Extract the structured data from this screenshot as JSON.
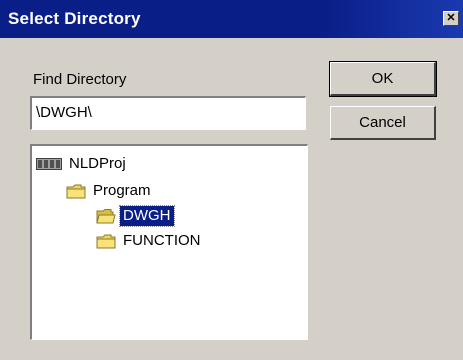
{
  "window": {
    "title": "Select Directory",
    "close_glyph": "✕"
  },
  "find": {
    "label": "Find Directory",
    "value": "\\DWGH\\"
  },
  "buttons": {
    "ok": "OK",
    "cancel": "Cancel"
  },
  "tree": {
    "items": [
      {
        "label": "NLDProj",
        "icon": "drive-icon",
        "level": 0,
        "selected": false
      },
      {
        "label": "Program",
        "icon": "folder-icon",
        "level": 1,
        "selected": false
      },
      {
        "label": "DWGH",
        "icon": "folder-open-icon",
        "level": 2,
        "selected": true
      },
      {
        "label": "FUNCTION",
        "icon": "folder-icon",
        "level": 2,
        "selected": false
      }
    ]
  },
  "colors": {
    "titlebar": "#0a1e88",
    "face": "#d4d0c8",
    "selection": "#0a1e88",
    "folder": "#f2d65a"
  }
}
